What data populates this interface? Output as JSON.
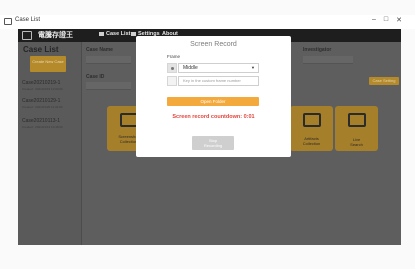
{
  "window": {
    "title": "Case List",
    "minimize": "–",
    "maximize": "□",
    "close": "✕"
  },
  "appbar": {
    "logo_text": "電騰存證王",
    "nav": [
      "Case List",
      "Settings",
      "About"
    ]
  },
  "sidebar": {
    "title": "Case List",
    "create_button": "Create New Case",
    "cases": [
      {
        "name": "Case20210219-1",
        "meta": "Created : 2021/02/19 12:00:00"
      },
      {
        "name": "Case20210129-1",
        "meta": "Created : 2021/01/29 11:32:00"
      },
      {
        "name": "Case20210113-1",
        "meta": "Created : 2021/01/13 10:48:00"
      }
    ]
  },
  "main": {
    "case_name_label": "Case Name",
    "case_id_label": "Case ID",
    "investigator_label": "Investigator",
    "case_setting_button": "Case Setting",
    "tiles": [
      {
        "label_line1": "Screenshot",
        "label_line2": "Collection"
      },
      {
        "label_line1": "Artifacts",
        "label_line2": "Collection"
      },
      {
        "label_line1": "Live",
        "label_line2": "Search"
      }
    ]
  },
  "modal": {
    "title": "Screen Record",
    "frame_label": "Frame",
    "frame_select_value": "Middle",
    "custom_frame_placeholder": "Key in the custom frame number",
    "open_folder_button": "Open Folder",
    "countdown_text": "Screen record countdown: 0:01",
    "stop_button_line1": "Stop",
    "stop_button_line2": "Recording"
  },
  "colors": {
    "accent": "#f3a93b",
    "warning_text": "#e2453c",
    "tile_bg": "#a67f2a"
  }
}
